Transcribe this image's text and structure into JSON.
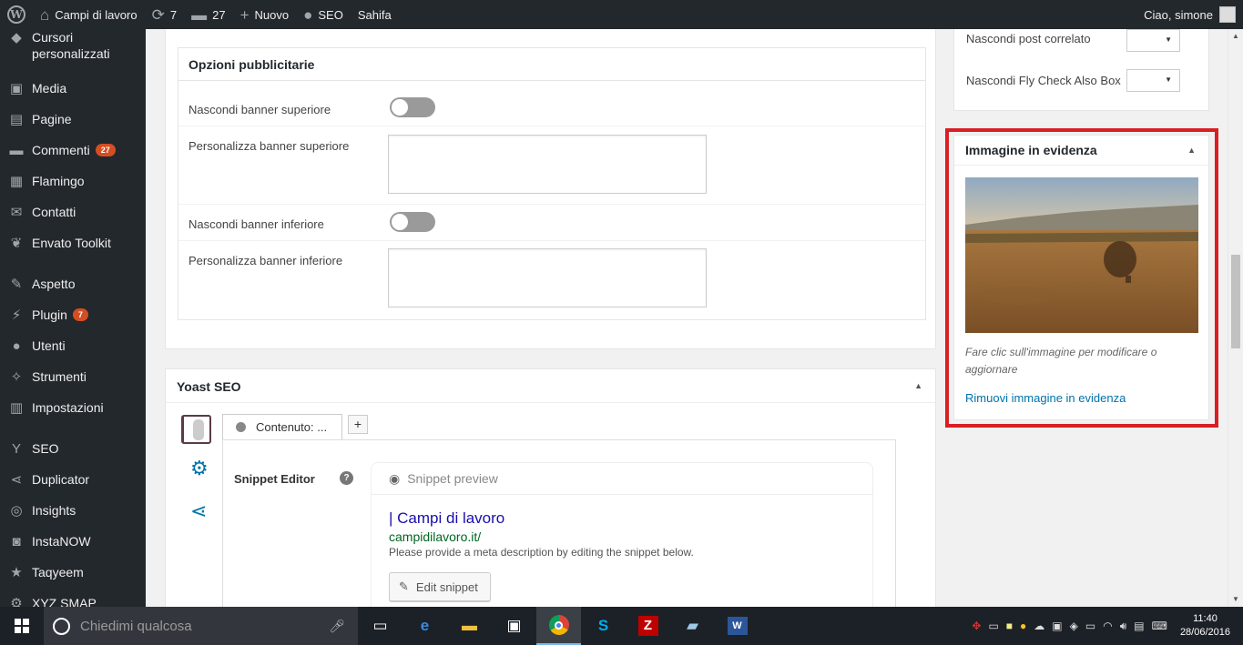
{
  "adminbar": {
    "site_name": "Campi di lavoro",
    "updates_count": "7",
    "comments_count": "27",
    "new_label": "Nuovo",
    "seo_label": "SEO",
    "theme_label": "Sahifa",
    "greeting": "Ciao, simone"
  },
  "sidebar": {
    "items": [
      {
        "label": "Cursori personalizzati",
        "icon": "cursor-icon"
      },
      {
        "label": "Media",
        "icon": "media-icon"
      },
      {
        "label": "Pagine",
        "icon": "pages-icon"
      },
      {
        "label": "Commenti",
        "icon": "comments-icon",
        "badge": "27"
      },
      {
        "label": "Flamingo",
        "icon": "flamingo-icon"
      },
      {
        "label": "Contatti",
        "icon": "mail-icon"
      },
      {
        "label": "Envato Toolkit",
        "icon": "leaf-icon"
      },
      {
        "label": "Aspetto",
        "icon": "brush-icon"
      },
      {
        "label": "Plugin",
        "icon": "plugin-icon",
        "badge": "7"
      },
      {
        "label": "Utenti",
        "icon": "user-icon"
      },
      {
        "label": "Strumenti",
        "icon": "wrench-icon"
      },
      {
        "label": "Impostazioni",
        "icon": "settings-icon"
      },
      {
        "label": "SEO",
        "icon": "yoast-icon"
      },
      {
        "label": "Duplicator",
        "icon": "share-icon"
      },
      {
        "label": "Insights",
        "icon": "insights-icon"
      },
      {
        "label": "InstaNOW",
        "icon": "instagram-icon"
      },
      {
        "label": "Taqyeem",
        "icon": "star-icon"
      },
      {
        "label": "XYZ SMAP",
        "icon": "gear-icon"
      }
    ]
  },
  "ads": {
    "title": "Opzioni pubblicitarie",
    "hide_top_label": "Nascondi banner superiore",
    "custom_top_label": "Personalizza banner superiore",
    "hide_bottom_label": "Nascondi banner inferiore",
    "custom_bottom_label": "Personalizza banner inferiore"
  },
  "yoast": {
    "title": "Yoast SEO",
    "tab_label": "Contenuto: ...",
    "add_tab": "+",
    "snippet_editor_label": "Snippet Editor",
    "help_icon": "?",
    "preview_label": "Snippet preview",
    "snippet_title": "| Campi di lavoro",
    "snippet_url": "campidilavoro.it/",
    "snippet_desc": "Please provide a meta description by editing the snippet below.",
    "edit_button": "Edit snippet"
  },
  "related": {
    "hide_related_label": "Nascondi post correlato",
    "hide_fly_label": "Nascondi Fly Check Also Box"
  },
  "featured": {
    "title": "Immagine in evidenza",
    "caption": "Fare clic sull'immagine per modificare o aggiornare",
    "remove_link": "Rimuovi immagine in evidenza"
  },
  "taskbar": {
    "search_placeholder": "Chiedimi qualcosa",
    "time": "11:40",
    "date": "28/06/2016"
  },
  "colors": {
    "accent": "#0073aa",
    "highlight_frame": "#d91e24",
    "badge": "#d54e21"
  }
}
